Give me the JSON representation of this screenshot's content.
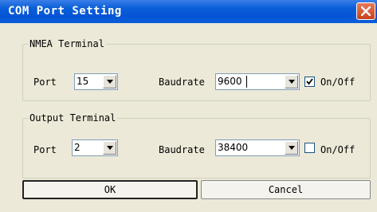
{
  "window": {
    "title": "COM Port Setting"
  },
  "nmea": {
    "legend": "NMEA Terminal",
    "port_label": "Port",
    "port_value": "15",
    "baud_label": "Baudrate",
    "baud_value": "9600",
    "toggle_label": "On/Off",
    "toggle_checked": true
  },
  "output": {
    "legend": "Output Terminal",
    "port_label": "Port",
    "port_value": "2",
    "baud_label": "Baudrate",
    "baud_value": "38400",
    "toggle_label": "On/Off",
    "toggle_checked": false
  },
  "buttons": {
    "ok": "OK",
    "cancel": "Cancel"
  },
  "icons": {
    "close": "close-icon",
    "dropdown": "chevron-down-icon",
    "check": "checkmark-icon"
  },
  "colors": {
    "title_bar": "#0554d6",
    "close_button": "#d0532a",
    "dialog_bg": "#ece9d8"
  }
}
